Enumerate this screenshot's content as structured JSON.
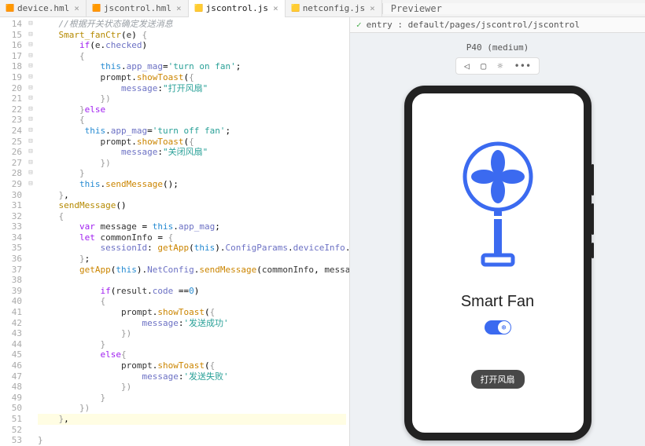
{
  "tabs": [
    {
      "label": "device.hml",
      "icon": "🟧",
      "active": false
    },
    {
      "label": "jscontrol.hml",
      "icon": "🟧",
      "active": false
    },
    {
      "label": "jscontrol.js",
      "icon": "🟨",
      "active": true
    },
    {
      "label": "netconfig.js",
      "icon": "🟨",
      "active": false
    }
  ],
  "previewer_tab": "Previewer",
  "breadcrumb": "entry : default/pages/jscontrol/jscontrol",
  "device_label": "P40 (medium)",
  "toolbar_icons": {
    "back": "◁",
    "rotate": "▢",
    "brightness": "☼",
    "more": "•••"
  },
  "app": {
    "title": "Smart Fan",
    "toggle_on": true,
    "toast": "打开风扇"
  },
  "gutter_start": 14,
  "gutter_end": 53,
  "code_lines": [
    {
      "t": "comment",
      "text": "    //根据开关状态确定发送消息"
    },
    {
      "t": "raw",
      "html": "    <span class='c-func'>Smart_fanCtr</span>(<span class='c-id'>e</span>) <span class='c-br'>{</span>"
    },
    {
      "t": "raw",
      "html": "        <span class='c-key'>if</span>(<span class='c-id'>e</span>.<span class='c-prop'>checked</span>)"
    },
    {
      "t": "raw",
      "html": "        <span class='c-br'>{</span>"
    },
    {
      "t": "raw",
      "html": "            <span class='c-this'>this</span>.<span class='c-prop'>app_mag</span>=<span class='c-str'>'turn on fan'</span>;"
    },
    {
      "t": "raw",
      "html": "            <span class='c-id'>prompt</span>.<span class='c-call'>showToast</span>(<span class='c-br'>{</span>"
    },
    {
      "t": "raw",
      "html": "                <span class='c-prop'>message</span>:<span class='c-str'>\"打开风扇\"</span>"
    },
    {
      "t": "raw",
      "html": "            <span class='c-br'>})</span>"
    },
    {
      "t": "raw",
      "html": "        <span class='c-br'>}</span><span class='c-key'>else</span>"
    },
    {
      "t": "raw",
      "html": "        <span class='c-br'>{</span>"
    },
    {
      "t": "raw",
      "html": "         <span class='c-this'>this</span>.<span class='c-prop'>app_mag</span>=<span class='c-str'>'turn off fan'</span>;"
    },
    {
      "t": "raw",
      "html": "            <span class='c-id'>prompt</span>.<span class='c-call'>showToast</span>(<span class='c-br'>{</span>"
    },
    {
      "t": "raw",
      "html": "                <span class='c-prop'>message</span>:<span class='c-str'>\"关闭风扇\"</span>"
    },
    {
      "t": "raw",
      "html": "            <span class='c-br'>})</span>"
    },
    {
      "t": "raw",
      "html": "        <span class='c-br'>}</span>"
    },
    {
      "t": "raw",
      "html": "        <span class='c-this'>this</span>.<span class='c-call'>sendMessage</span>();"
    },
    {
      "t": "raw",
      "html": "    <span class='c-br'>}</span>,"
    },
    {
      "t": "raw",
      "html": "    <span class='c-func'>sendMessage</span>()"
    },
    {
      "t": "raw",
      "html": "    <span class='c-br'>{</span>"
    },
    {
      "t": "raw",
      "html": "        <span class='c-var'>var</span> <span class='c-id'>message</span> = <span class='c-this'>this</span>.<span class='c-prop'>app_mag</span>;"
    },
    {
      "t": "raw",
      "html": "        <span class='c-var'>let</span> <span class='c-id'>commonInfo</span> = <span class='c-br'>{</span>"
    },
    {
      "t": "raw",
      "html": "            <span class='c-prop'>sessionId</span>: <span class='c-call'>getApp</span>(<span class='c-this'>this</span>).<span class='c-prop'>ConfigParams</span>.<span class='c-prop'>deviceInfo</span>.<span class='c-prop'>sessionId</span>"
    },
    {
      "t": "raw",
      "html": "        <span class='c-br'>}</span>;"
    },
    {
      "t": "raw",
      "html": "        <span class='c-call'>getApp</span>(<span class='c-this'>this</span>).<span class='c-prop'>NetConfig</span>.<span class='c-call'>sendMessage</span>(<span class='c-id'>commonInfo</span>, <span class='c-id'>message</span>,(<span class='c-id'>result</span>)=&gt;<span class='c-br'>{</span>"
    },
    {
      "t": "raw",
      "html": ""
    },
    {
      "t": "raw",
      "html": "            <span class='c-key'>if</span>(<span class='c-id'>result</span>.<span class='c-prop'>code</span> ==<span class='c-num'>0</span>)"
    },
    {
      "t": "raw",
      "html": "            <span class='c-br'>{</span>"
    },
    {
      "t": "raw",
      "html": "                <span class='c-id'>prompt</span>.<span class='c-call'>showToast</span>(<span class='c-br'>{</span>"
    },
    {
      "t": "raw",
      "html": "                    <span class='c-prop'>message</span>:<span class='c-str'>'发送成功'</span>"
    },
    {
      "t": "raw",
      "html": "                <span class='c-br'>})</span>"
    },
    {
      "t": "raw",
      "html": "            <span class='c-br'>}</span>"
    },
    {
      "t": "raw",
      "html": "            <span class='c-key'>else</span><span class='c-br'>{</span>"
    },
    {
      "t": "raw",
      "html": "                <span class='c-id'>prompt</span>.<span class='c-call'>showToast</span>(<span class='c-br'>{</span>"
    },
    {
      "t": "raw",
      "html": "                    <span class='c-prop'>message</span>:<span class='c-str'>'发送失败'</span>"
    },
    {
      "t": "raw",
      "html": "                <span class='c-br'>})</span>"
    },
    {
      "t": "raw",
      "html": "            <span class='c-br'>}</span>"
    },
    {
      "t": "raw",
      "html": "        <span class='c-br'>})</span>"
    },
    {
      "t": "raw",
      "html": "    <span class='c-br'>}</span>,",
      "hl": true
    },
    {
      "t": "raw",
      "html": "<span class='c-br'>}</span>"
    }
  ]
}
